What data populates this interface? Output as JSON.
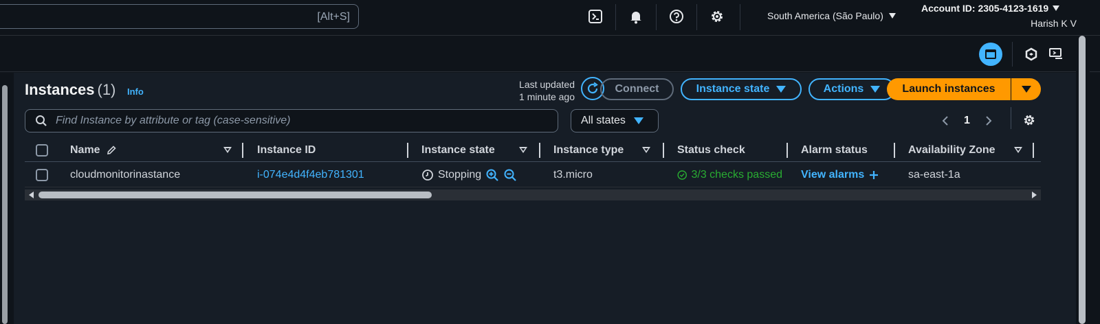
{
  "topnav": {
    "search_shortcut": "[Alt+S]",
    "icons": [
      "cloudshell-icon",
      "bell-icon",
      "help-icon",
      "gear-icon"
    ],
    "region": "South America (São Paulo)",
    "account_id": "Account ID: 2305-4123-1619",
    "user_name": "Harish K V"
  },
  "header": {
    "title": "Instances",
    "count": "(1)",
    "info": "Info",
    "last_updated_line1": "Last updated",
    "last_updated_line2": "1 minute ago",
    "connect": "Connect",
    "instance_state": "Instance state",
    "actions": "Actions",
    "launch": "Launch instances"
  },
  "filters": {
    "search_placeholder": "Find Instance by attribute or tag (case-sensitive)",
    "states_value": "All states",
    "page": "1"
  },
  "table": {
    "columns": {
      "name": "Name",
      "instance_id": "Instance ID",
      "instance_state": "Instance state",
      "instance_type": "Instance type",
      "status_check": "Status check",
      "alarm_status": "Alarm status",
      "availability_zone": "Availability Zone"
    },
    "row": {
      "name": "cloudmonitorinastance",
      "instance_id": "i-074e4d4f4eb781301",
      "state": "Stopping",
      "type": "t3.micro",
      "status_check": "3/3 checks passed",
      "alarm": "View alarms",
      "zone": "sa-east-1a"
    }
  },
  "colors": {
    "accent": "#42b4ff",
    "launch": "#ff9900",
    "ok": "#29ad32",
    "background": "#0f141a",
    "panel": "#161d26"
  }
}
